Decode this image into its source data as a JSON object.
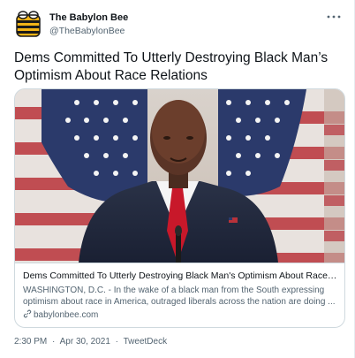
{
  "account": {
    "name": "The Babylon Bee",
    "handle": "@TheBabylonBee"
  },
  "tweet": {
    "text": "Dems Committed To Utterly Destroying Black Man’s Optimism About Race Relations"
  },
  "card": {
    "title": "Dems Committed To Utterly Destroying Black Man's Optimism About Race Relat...",
    "description": "WASHINGTON, D.C. - In the wake of a black man from the South expressing optimism about race in America, outraged liberals across the nation are doing ...",
    "domain": "babylonbee.com"
  },
  "meta": {
    "time": "2:30 PM",
    "date": "Apr 30, 2021",
    "source": "TweetDeck",
    "separator": "·"
  },
  "icons": {
    "avatar": "bee-logo-icon",
    "more": "more-horizontal-icon",
    "link": "link-icon"
  },
  "colors": {
    "text_primary": "#0f1419",
    "text_secondary": "#536471",
    "border": "#cfd9de",
    "brand_yellow": "#f2b417"
  }
}
